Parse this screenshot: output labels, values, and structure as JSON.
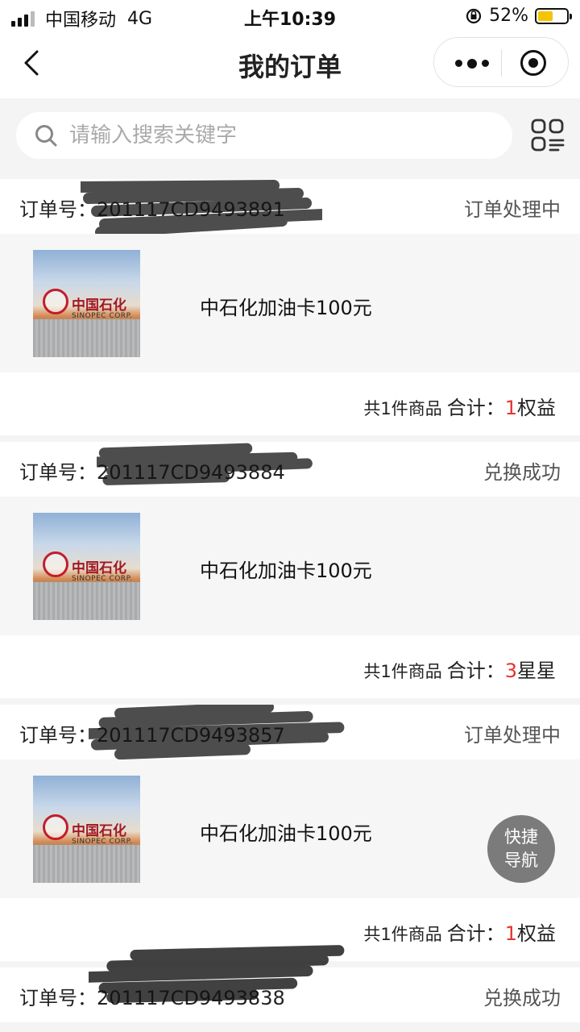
{
  "status_bar": {
    "carrier": "中国移动",
    "network": "4G",
    "time": "上午10:39",
    "battery_percent": "52%",
    "battery_level": 0.52,
    "battery_color": "#f5c400"
  },
  "nav": {
    "title": "我的订单",
    "back_icon": "chevron-left-icon",
    "more_icon": "more-dots-icon",
    "close_icon": "target-circle-icon"
  },
  "search": {
    "placeholder": "请输入搜索关键字",
    "value": "",
    "icon": "search-icon",
    "filter_icon": "grid-list-icon"
  },
  "orders": [
    {
      "label": "订单号：",
      "number": "201117CD9493891",
      "status": "订单处理中",
      "product_name": "中石化加油卡100元",
      "image_brand": "中国石化",
      "image_brand_sub": "SINOPEC CORP.",
      "item_count": "共1件商品",
      "total_label": "合计：",
      "total_value": "1",
      "total_unit": "权益"
    },
    {
      "label": "订单号：",
      "number": "201117CD9493884",
      "status": "兑换成功",
      "product_name": "中石化加油卡100元",
      "image_brand": "中国石化",
      "image_brand_sub": "SINOPEC CORP.",
      "item_count": "共1件商品",
      "total_label": "合计：",
      "total_value": "3",
      "total_unit": "星星"
    },
    {
      "label": "订单号：",
      "number": "201117CD9493857",
      "status": "订单处理中",
      "product_name": "中石化加油卡100元",
      "image_brand": "中国石化",
      "image_brand_sub": "SINOPEC CORP.",
      "item_count": "共1件商品",
      "total_label": "合计：",
      "total_value": "1",
      "total_unit": "权益"
    },
    {
      "label": "订单号：",
      "number": "201117CD9493838",
      "status": "兑换成功"
    }
  ],
  "fab": {
    "line1": "快捷",
    "line2": "导航"
  },
  "colors": {
    "accent_red": "#e2352e",
    "background": "#f4f4f4"
  }
}
